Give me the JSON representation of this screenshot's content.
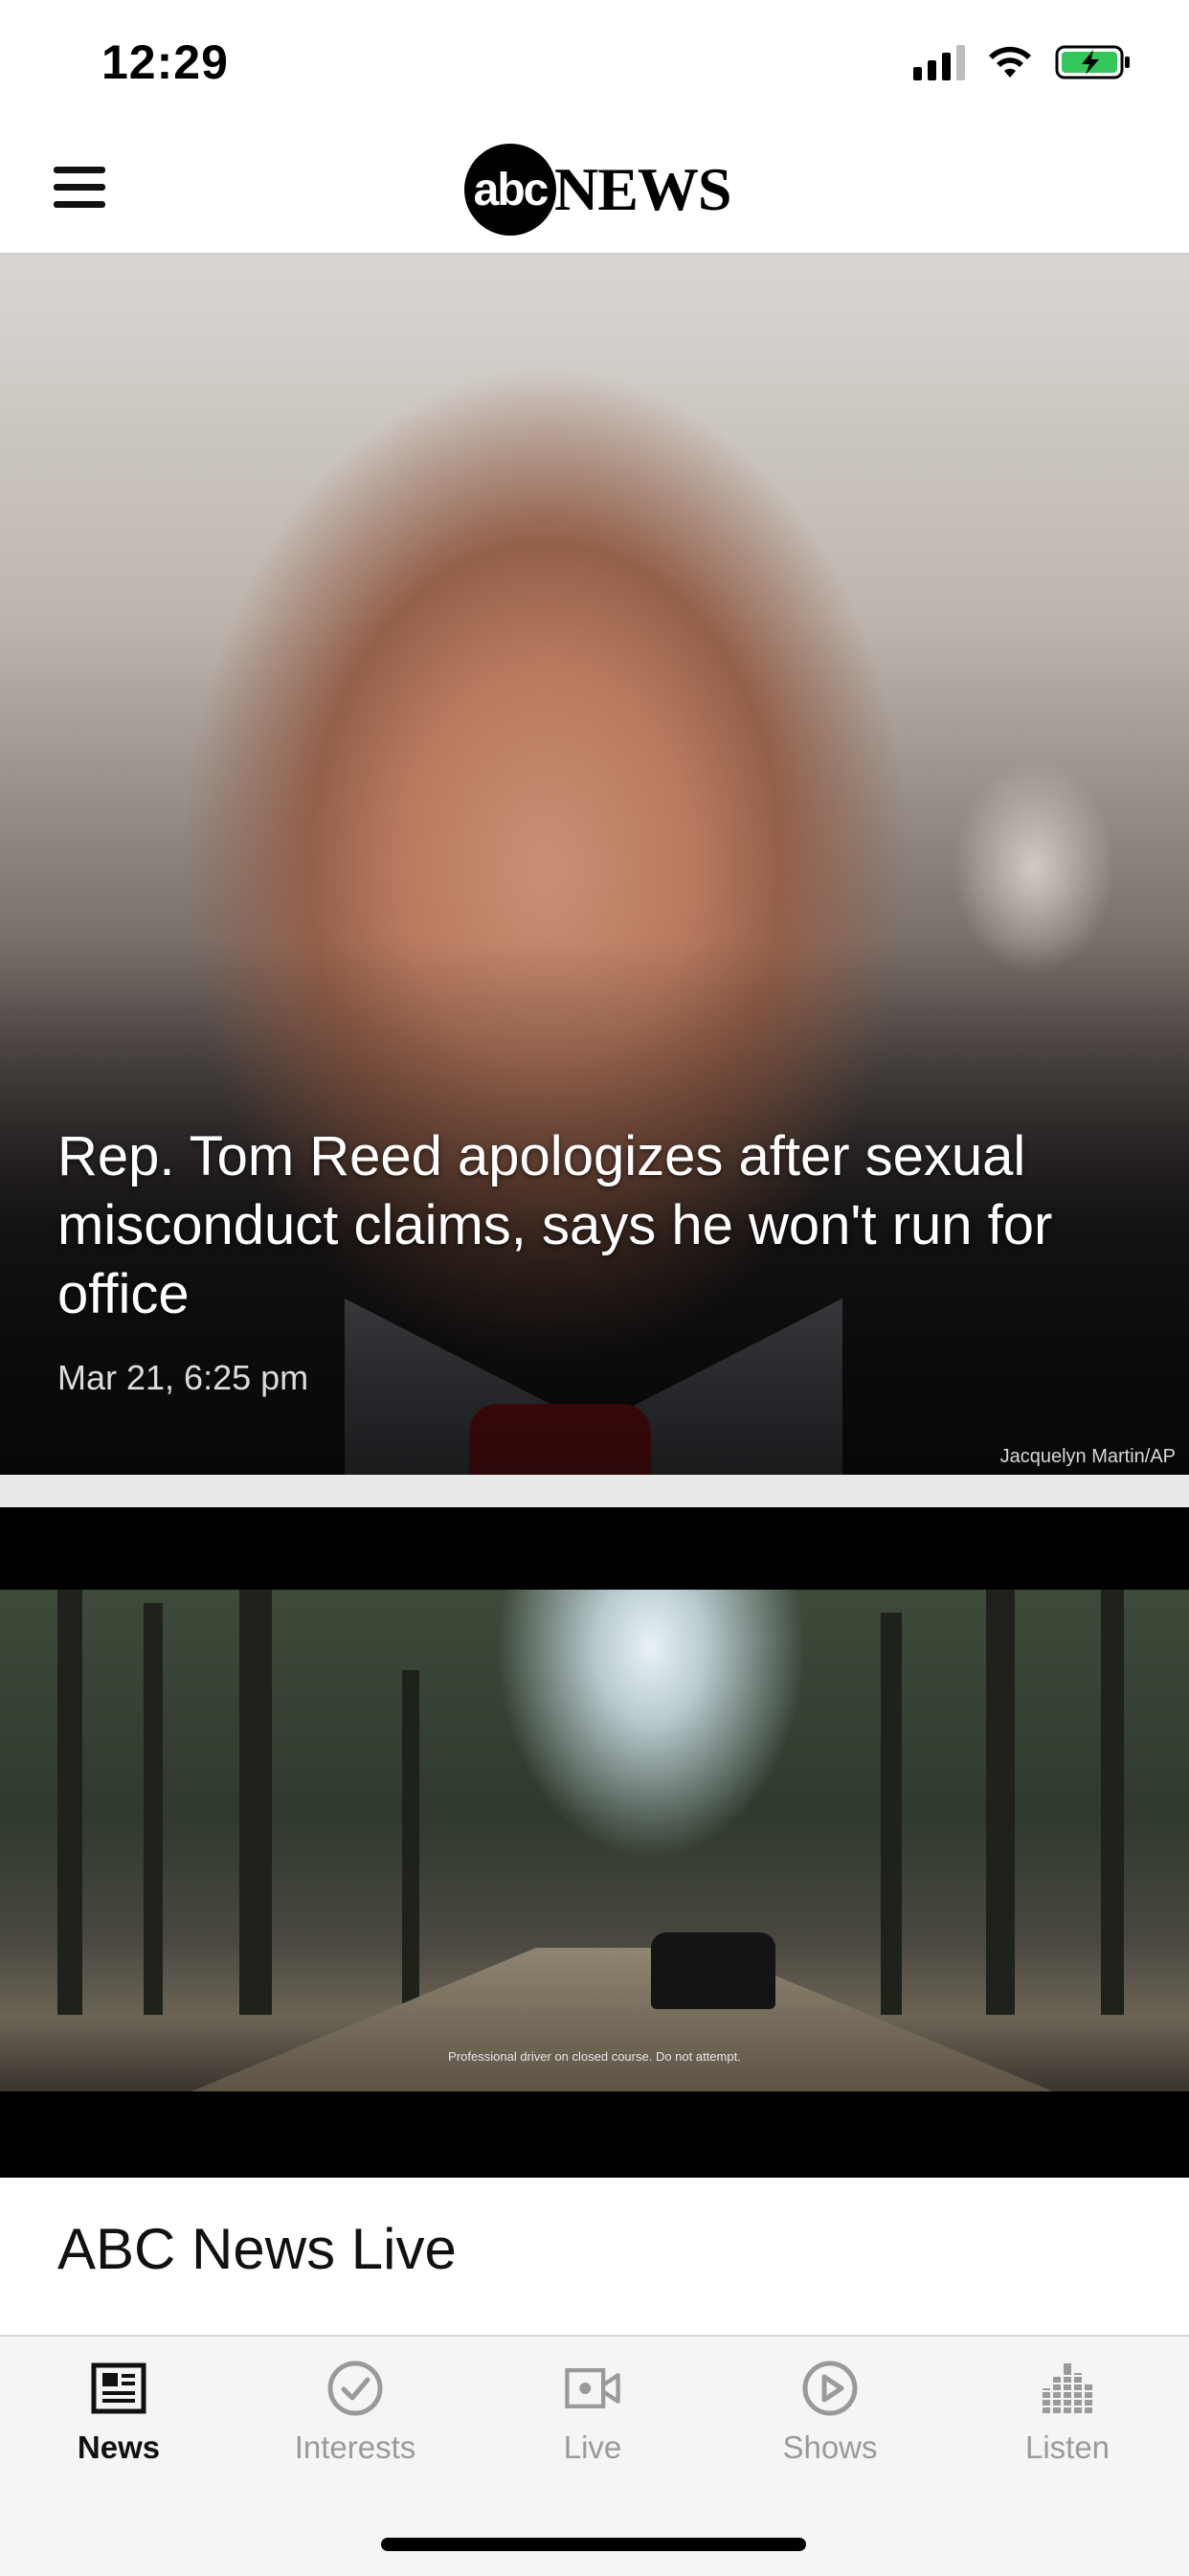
{
  "status_bar": {
    "time": "12:29",
    "icons": [
      "cellular-signal-icon",
      "wifi-icon",
      "battery-charging-icon"
    ],
    "battery_color": "#34c759"
  },
  "header": {
    "menu_icon": "hamburger-menu-icon",
    "logo_mark": "abc",
    "logo_word": "NEWS"
  },
  "hero": {
    "title": "Rep. Tom Reed apologizes after sexual misconduct claims, says he won't run for office",
    "timestamp": "Mar 21, 6:25 pm",
    "photo_credit": "Jacquelyn Martin/AP"
  },
  "ad": {
    "disclaimer": "Professional driver on closed course. Do not attempt."
  },
  "section": {
    "title": "ABC News Live"
  },
  "tabs": [
    {
      "label": "News",
      "icon": "newspaper-icon",
      "active": true
    },
    {
      "label": "Interests",
      "icon": "checkmark-circle-icon",
      "active": false
    },
    {
      "label": "Live",
      "icon": "video-camera-icon",
      "active": false
    },
    {
      "label": "Shows",
      "icon": "play-circle-icon",
      "active": false
    },
    {
      "label": "Listen",
      "icon": "audio-bars-icon",
      "active": false
    }
  ],
  "colors": {
    "tab_active": "#111111",
    "tab_inactive": "#9a9a9a"
  }
}
